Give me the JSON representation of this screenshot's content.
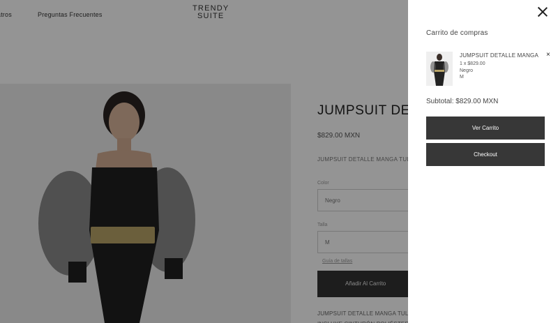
{
  "header": {
    "nav_left_partial": "asatros",
    "nav_faq": "Preguntas Frecuentes",
    "logo_line1": "TRENDY",
    "logo_line2": "SUITE"
  },
  "product": {
    "title": "JUMPSUIT DETALLE MANGA TUL",
    "price": "$829.00 MXN",
    "short_description": "JUMPSUIT DETALLE MANGA TUL",
    "color_label": "Color",
    "color_value": "Negro",
    "size_label": "Talla",
    "size_value": "M",
    "size_guide": "Guía de tallas",
    "add_to_cart": "Añadir Al Carrito",
    "long_description": "JUMPSUIT DETALLE MANGA TUL INCLUYE CINTURÓN POLIÉSTER"
  },
  "cart": {
    "title": "Carrito de compras",
    "item": {
      "name": "JUMPSUIT DETALLE MANGA",
      "qty_price": "1 x $829.00",
      "color": "Negro",
      "size": "M",
      "remove_symbol": "×"
    },
    "subtotal": "Subtotal: $829.00 MXN",
    "view_cart": "Ver Carrito",
    "checkout": "Checkout"
  },
  "colors": {
    "overlay": "rgba(0,0,0,0.42)",
    "button_dark": "#373737"
  }
}
